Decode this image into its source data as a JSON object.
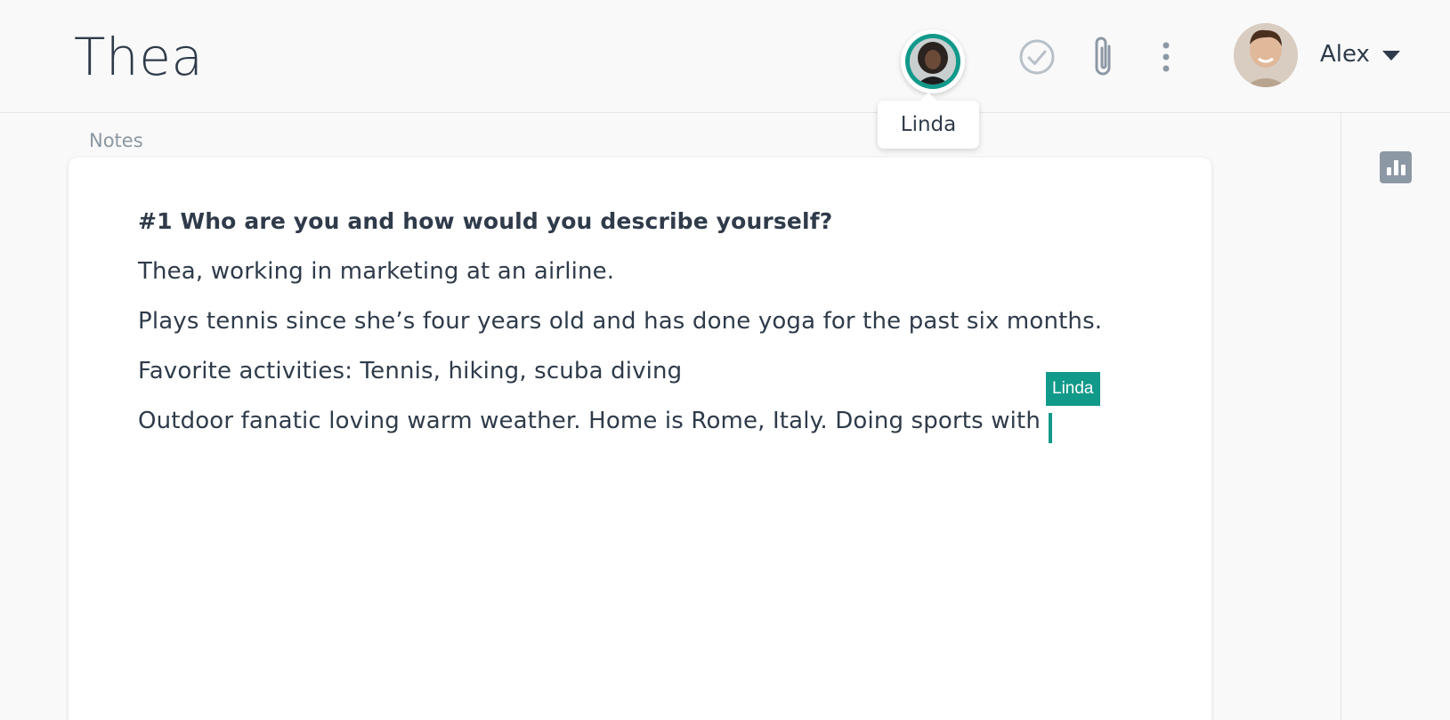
{
  "header": {
    "title": "Thea",
    "collaborator": {
      "name": "Linda",
      "ring_color": "#11998a",
      "icon": "avatar"
    },
    "actions": [
      {
        "name": "mark-complete",
        "icon": "check-circle-icon"
      },
      {
        "name": "attach",
        "icon": "paperclip-icon"
      },
      {
        "name": "more",
        "icon": "more-vertical-icon"
      }
    ],
    "user": {
      "name": "Alex",
      "icon": "chevron-down-icon"
    }
  },
  "notes": {
    "label": "Notes",
    "heading": "#1 Who are you and how would you describe yourself?",
    "lines": [
      "Thea, working in marketing at an airline.",
      "Plays tennis since she’s four years old and has done yoga for the past six months.",
      "Favorite activities: Tennis, hiking, scuba diving",
      "Outdoor fanatic loving warm weather. Home is Rome, Italy. Doing sports with"
    ],
    "live_cursor": {
      "user": "Linda",
      "color": "#11998a"
    }
  },
  "sidebar": {
    "stats_icon": "bar-chart-icon"
  },
  "colors": {
    "accent": "#11998a",
    "text": "#2f3b4a",
    "muted": "#8c96a1"
  }
}
